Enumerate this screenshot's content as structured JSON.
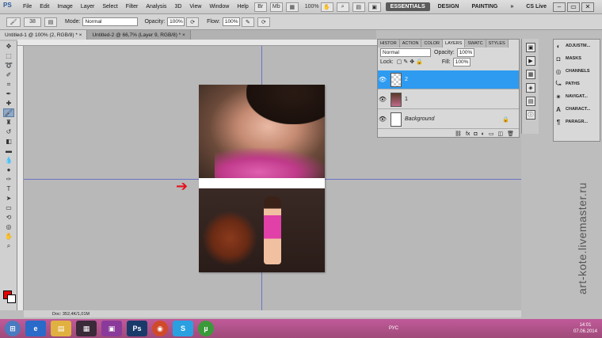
{
  "app": {
    "logo": "PS"
  },
  "menu": [
    "File",
    "Edit",
    "Image",
    "Layer",
    "Select",
    "Filter",
    "Analysis",
    "3D",
    "View",
    "Window",
    "Help"
  ],
  "zoom_menu": "100%",
  "workspaces": [
    "ESSENTIALS",
    "DESIGN",
    "PAINTING"
  ],
  "active_workspace": "ESSENTIALS",
  "cslive": "CS Live",
  "options": {
    "brush_size": "38",
    "mode_label": "Mode:",
    "mode_value": "Normal",
    "opacity_label": "Opacity:",
    "opacity_value": "100%",
    "flow_label": "Flow:",
    "flow_value": "100%"
  },
  "tabs": [
    "Untitled-1 @ 100% (2, RGB/8) *",
    "Untitled-2 @ 66,7% (Layer 9, RGB/8) *"
  ],
  "layers_panel": {
    "tabs": [
      "HISTOR",
      "ACTION",
      "COLOR",
      "LAYERS",
      "SWATC",
      "STYLES"
    ],
    "active_tab": "LAYERS",
    "blend_mode": "Normal",
    "opacity_label": "Opacity:",
    "opacity_value": "100%",
    "lock_label": "Lock:",
    "fill_label": "Fill:",
    "fill_value": "100%",
    "layers": [
      {
        "name": "2",
        "selected": true
      },
      {
        "name": "1",
        "selected": false
      },
      {
        "name": "Background",
        "selected": false
      }
    ]
  },
  "dock": [
    "ADJUSTM...",
    "MASKS",
    "CHANNELS",
    "PATHS",
    "NAVIGAT...",
    "CHARACT...",
    "PARAGR..."
  ],
  "status": "Doc: 352,4K/1,01M",
  "watermark": "art-kote.livemaster.ru",
  "taskbar": {
    "lang": "РУС",
    "time": "14:01",
    "date": "07.06.2014"
  },
  "colors": {
    "foreground": "#e60000",
    "background": "#ffffff",
    "selection": "#2e9bf0",
    "taskbar": "#b04f8a"
  }
}
